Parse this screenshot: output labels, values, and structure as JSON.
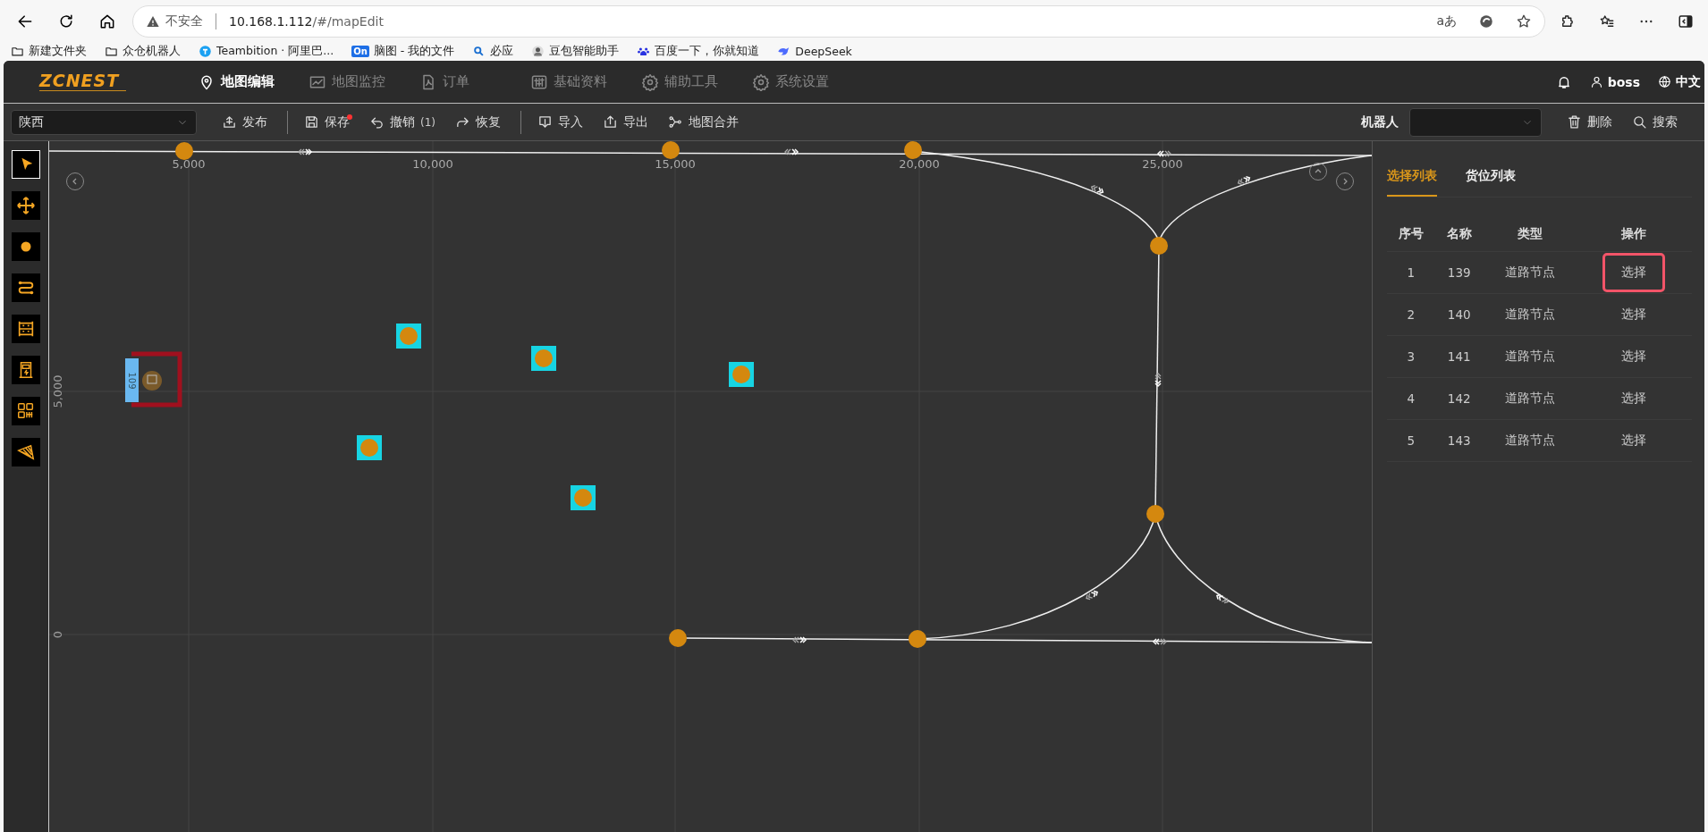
{
  "browser": {
    "security": "不安全",
    "url_host": "10.168.1.112",
    "url_path": "/#/mapEdit",
    "translate": "aあ",
    "bookmarks": [
      {
        "label": "新建文件夹"
      },
      {
        "label": "众仓机器人"
      },
      {
        "label": "Teambition · 阿里巴..."
      },
      {
        "label": "脑图 - 我的文件",
        "badge": "On"
      },
      {
        "label": "必应"
      },
      {
        "label": "豆包智能助手"
      },
      {
        "label": "百度一下，你就知道"
      },
      {
        "label": "DeepSeek"
      }
    ]
  },
  "app": {
    "logo": "ZCNEST",
    "nav": [
      {
        "label": "地图编辑",
        "selected": true
      },
      {
        "label": "地图监控",
        "selected": false
      },
      {
        "label": "订单",
        "selected": false
      },
      {
        "label": "基础资料",
        "selected": false
      },
      {
        "label": "辅助工具",
        "selected": false
      },
      {
        "label": "系统设置",
        "selected": false
      }
    ],
    "user": "boss",
    "language": "中文"
  },
  "toolbar": {
    "map_select": "陕西",
    "actions": [
      {
        "label": "发布",
        "unsaved_dot": false,
        "divider_after": true
      },
      {
        "label": "保存",
        "unsaved_dot": true,
        "divider_after": false
      },
      {
        "label": "撤销",
        "count": "(1)",
        "unsaved_dot": false,
        "divider_after": false
      },
      {
        "label": "恢复",
        "unsaved_dot": false,
        "divider_after": true
      },
      {
        "label": "导入",
        "unsaved_dot": false,
        "divider_after": false
      },
      {
        "label": "导出",
        "unsaved_dot": false,
        "divider_after": false
      },
      {
        "label": "地图合并",
        "unsaved_dot": false,
        "divider_after": false
      }
    ],
    "robot_label": "机器人",
    "right_actions": [
      {
        "label": "删除"
      },
      {
        "label": "搜索"
      }
    ]
  },
  "tools": [
    {
      "selected": true
    },
    {
      "selected": false
    },
    {
      "selected": false
    },
    {
      "selected": false
    },
    {
      "selected": false
    },
    {
      "selected": false
    },
    {
      "selected": false
    },
    {
      "selected": false
    }
  ],
  "map": {
    "x_labels": [
      "5,000",
      "10,000",
      "15,000",
      "20,000",
      "25,000"
    ],
    "y_labels": [
      "5,000",
      "0"
    ],
    "storage": {
      "label": "109"
    }
  },
  "panel": {
    "tabs": [
      {
        "label": "选择列表",
        "selected": true
      },
      {
        "label": "货位列表",
        "selected": false
      }
    ],
    "columns": [
      "序号",
      "名称",
      "类型",
      "操作"
    ],
    "rows": [
      {
        "index": "1",
        "name": "139",
        "type": "道路节点",
        "action": "选择",
        "highlighted": true
      },
      {
        "index": "2",
        "name": "140",
        "type": "道路节点",
        "action": "选择",
        "highlighted": false
      },
      {
        "index": "3",
        "name": "141",
        "type": "道路节点",
        "action": "选择",
        "highlighted": false
      },
      {
        "index": "4",
        "name": "142",
        "type": "道路节点",
        "action": "选择",
        "highlighted": false
      },
      {
        "index": "5",
        "name": "143",
        "type": "道路节点",
        "action": "选择",
        "highlighted": false
      }
    ]
  }
}
